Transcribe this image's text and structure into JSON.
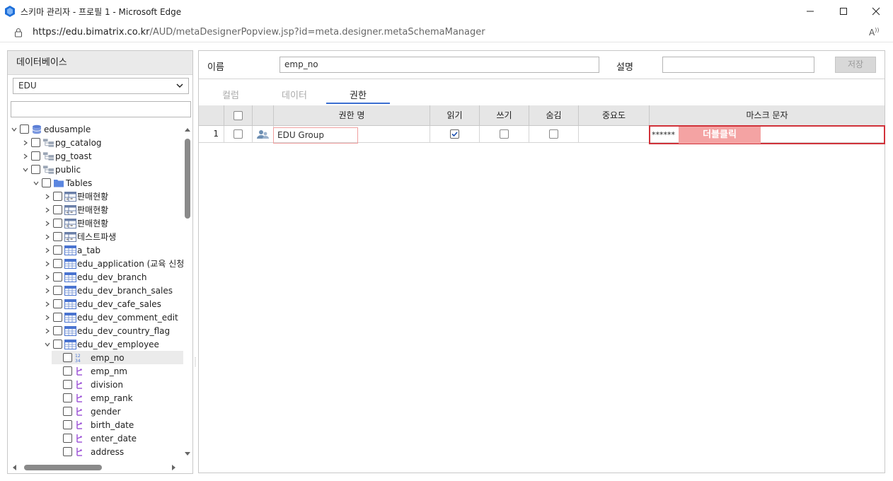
{
  "window": {
    "title": "스키마 관리자 - 프로필 1 - Microsoft Edge",
    "url": "https://edu.bimatrix.co.kr/AUD/metaDesignerPopview.jsp?id=meta.designer.metaSchemaManager",
    "url_host": "https://edu.bimatrix.co.kr",
    "url_path": "/AUD/metaDesignerPopview.jsp?id=meta.designer.metaSchemaManager"
  },
  "left_panel": {
    "header": "데이터베이스",
    "db_selected": "EDU",
    "search_value": "",
    "tree": [
      {
        "label": "edusample",
        "level": 0,
        "icon": "database-icon",
        "expanded": true
      },
      {
        "label": "pg_catalog",
        "level": 1,
        "icon": "schema-icon",
        "expanded": false
      },
      {
        "label": "pg_toast",
        "level": 1,
        "icon": "schema-icon",
        "expanded": false
      },
      {
        "label": "public",
        "level": 1,
        "icon": "schema-icon",
        "expanded": true
      },
      {
        "label": "Tables",
        "level": 2,
        "icon": "folder-icon",
        "expanded": true
      },
      {
        "label": "판매현황",
        "level": 3,
        "icon": "pivot-table-icon",
        "expanded": false
      },
      {
        "label": "판매현황",
        "level": 3,
        "icon": "pivot-table-icon",
        "expanded": false
      },
      {
        "label": "판매현황",
        "level": 3,
        "icon": "pivot-table-icon",
        "expanded": false
      },
      {
        "label": "테스트파생",
        "level": 3,
        "icon": "pivot-table-icon",
        "expanded": false
      },
      {
        "label": "a_tab",
        "level": 3,
        "icon": "table-icon",
        "expanded": false
      },
      {
        "label": "edu_application (교육 신청",
        "level": 3,
        "icon": "table-icon",
        "expanded": false
      },
      {
        "label": "edu_dev_branch",
        "level": 3,
        "icon": "table-icon",
        "expanded": false
      },
      {
        "label": "edu_dev_branch_sales",
        "level": 3,
        "icon": "table-icon",
        "expanded": false
      },
      {
        "label": "edu_dev_cafe_sales",
        "level": 3,
        "icon": "table-icon",
        "expanded": false
      },
      {
        "label": "edu_dev_comment_edit",
        "level": 3,
        "icon": "table-icon",
        "expanded": false
      },
      {
        "label": "edu_dev_country_flag",
        "level": 3,
        "icon": "table-icon",
        "expanded": false
      },
      {
        "label": "edu_dev_employee",
        "level": 3,
        "icon": "table-icon",
        "expanded": true
      },
      {
        "label": "emp_no",
        "level": 4,
        "icon": "numeric-column-icon",
        "selected": true
      },
      {
        "label": "emp_nm",
        "level": 4,
        "icon": "string-column-icon"
      },
      {
        "label": "division",
        "level": 4,
        "icon": "string-column-icon"
      },
      {
        "label": "emp_rank",
        "level": 4,
        "icon": "string-column-icon"
      },
      {
        "label": "gender",
        "level": 4,
        "icon": "string-column-icon"
      },
      {
        "label": "birth_date",
        "level": 4,
        "icon": "string-column-icon"
      },
      {
        "label": "enter_date",
        "level": 4,
        "icon": "string-column-icon"
      },
      {
        "label": "address",
        "level": 4,
        "icon": "string-column-icon"
      }
    ]
  },
  "form": {
    "name_label": "이름",
    "name_value": "emp_no",
    "desc_label": "설명",
    "desc_value": "",
    "save_label": "저장"
  },
  "tabs": [
    {
      "label": "컬럼",
      "active": false
    },
    {
      "label": "데이터",
      "active": false
    },
    {
      "label": "권한",
      "active": true
    }
  ],
  "grid": {
    "headers": {
      "name": "권한 명",
      "read": "읽기",
      "write": "쓰기",
      "hide": "숨김",
      "importance": "중요도",
      "mask": "마스크 문자"
    },
    "rows": [
      {
        "num": "1",
        "name": "EDU Group",
        "read": true,
        "write": false,
        "hide": false,
        "importance": "",
        "mask": "******"
      }
    ],
    "hint_label": "더블클릭"
  },
  "colors": {
    "accent": "#3b6fd1",
    "highlight_border": "#d1323a",
    "hint_bg": "#f4a3a3",
    "db_icon": "#5b7fd6",
    "column_icon": "#9b4fd6"
  }
}
